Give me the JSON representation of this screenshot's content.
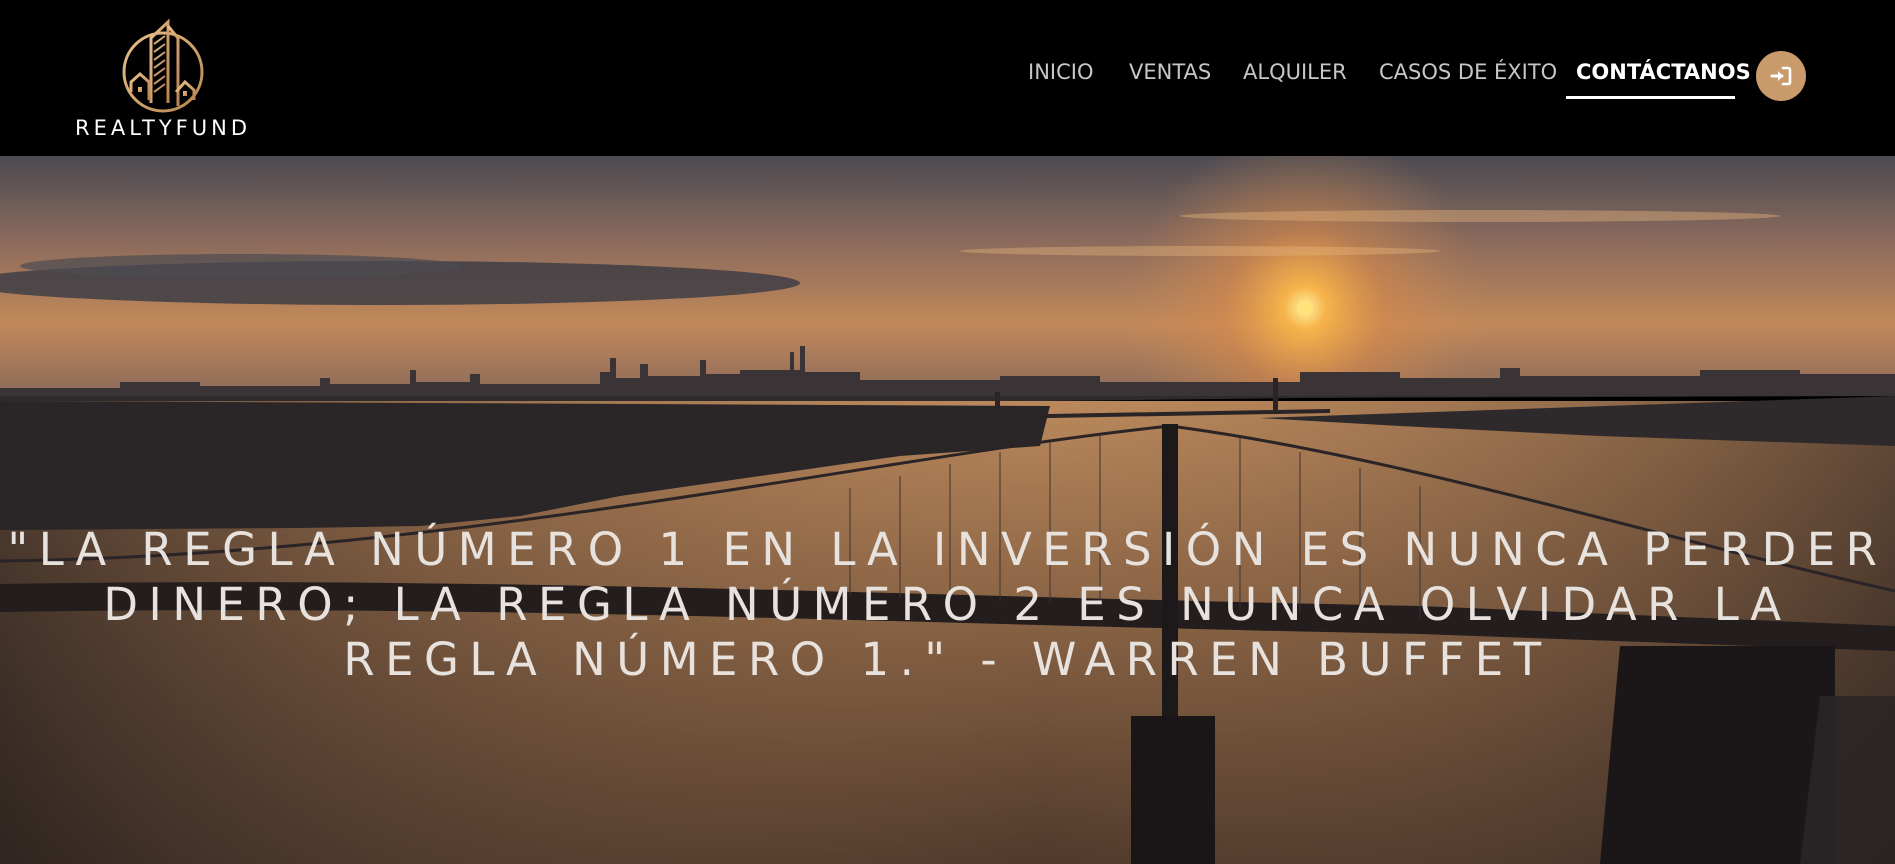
{
  "brand": {
    "name": "REALTYFUND",
    "logo_icon": "building-circle-logo",
    "accent_color": "#c99b6c"
  },
  "nav": {
    "items": [
      {
        "label": "INICIO"
      },
      {
        "label": "VENTAS"
      },
      {
        "label": "ALQUILER"
      },
      {
        "label": "CASOS DE ÉXITO"
      },
      {
        "label": "CONTÁCTANOS",
        "active": true
      }
    ],
    "login_icon": "sign-in-icon"
  },
  "hero": {
    "background": "aerial sunset bridge video",
    "quote": "\"LA REGLA NÚMERO 1 EN LA INVERSIÓN ES NUNCA PERDER DINERO; LA REGLA NÚMERO 2 ES NUNCA OLVIDAR LA REGLA NÚMERO 1.\" - WARREN BUFFET"
  }
}
